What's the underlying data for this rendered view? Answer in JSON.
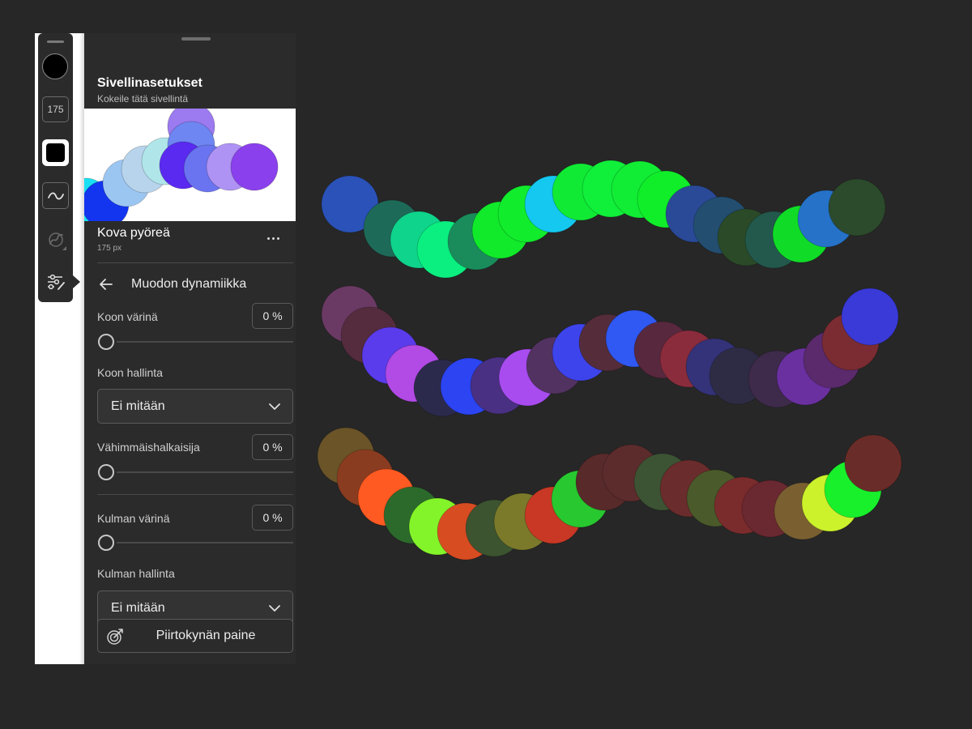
{
  "rail": {
    "size_value": "175",
    "icons": [
      "brush-color-swatch",
      "brush-size",
      "opacity-swatch",
      "smoothing-wave-icon",
      "pressure-icon",
      "brush-settings-icon"
    ]
  },
  "panel": {
    "title": "Sivellinasetukset",
    "subtitle": "Kokeile tätä sivellintä",
    "brush_name": "Kova pyöreä",
    "brush_size": "175 px",
    "section_title": "Muodon dynamiikka",
    "size_jitter": {
      "label": "Koon värinä",
      "value": "0 %",
      "level": 0
    },
    "size_control": {
      "label": "Koon hallinta",
      "value": "Ei mitään"
    },
    "min_diameter": {
      "label": "Vähimmäishalkaisija",
      "value": "0 %",
      "level": 0
    },
    "angle_jitter": {
      "label": "Kulman värinä",
      "value": "0 %",
      "level": 0
    },
    "angle_control": {
      "label": "Kulman hallinta",
      "value": "Ei mitään"
    },
    "pen_pressure": {
      "label": "Piirtokynän paine"
    }
  },
  "colors": {
    "background": "#272727",
    "panel": "#2b2b2b",
    "preview_dabs": [
      "#19e0f2",
      "#1335f0",
      "#9cc6f2",
      "#b8d4ec",
      "#b0e6ea",
      "#9c7af0",
      "#6e86f2",
      "#5a2af0",
      "#6a74f0",
      "#ae92f4",
      "#8a40ec"
    ],
    "stroke1": [
      "#2a52b8",
      "#1e6a58",
      "#0fd48c",
      "#0bef80",
      "#1a8c5c",
      "#11ea2a",
      "#11ec2c",
      "#14c8f0",
      "#10ea34",
      "#10ef3a",
      "#11ec34",
      "#10ee2a",
      "#2a4a98",
      "#234e70",
      "#2a4a28",
      "#23584c",
      "#10dc28",
      "#2672c8",
      "#2c4a2c"
    ],
    "stroke2": [
      "#6a3a64",
      "#552c3e",
      "#5a3cec",
      "#b24ae6",
      "#2c2a4c",
      "#2c44f2",
      "#4a3082",
      "#a84cf0",
      "#523260",
      "#3e44ec",
      "#542c3a",
      "#3058f2",
      "#58283e",
      "#8a2c3c",
      "#343278",
      "#2e2c44",
      "#3e2a4a",
      "#6a30a0",
      "#5a2a6c",
      "#7a2c32",
      "#3a3ad8"
    ],
    "stroke3": [
      "#6a5428",
      "#8a3c20",
      "#ff5a22",
      "#2c6a2c",
      "#84f42a",
      "#d84c22",
      "#3c5430",
      "#7a7a2a",
      "#c83824",
      "#28c830",
      "#582a2a",
      "#5c2c2c",
      "#3c5434",
      "#6a2c2c",
      "#4a5a2a",
      "#7a2c2c",
      "#6a2830",
      "#7a6030",
      "#ccf22c",
      "#18f02c",
      "#6a2c28"
    ]
  }
}
